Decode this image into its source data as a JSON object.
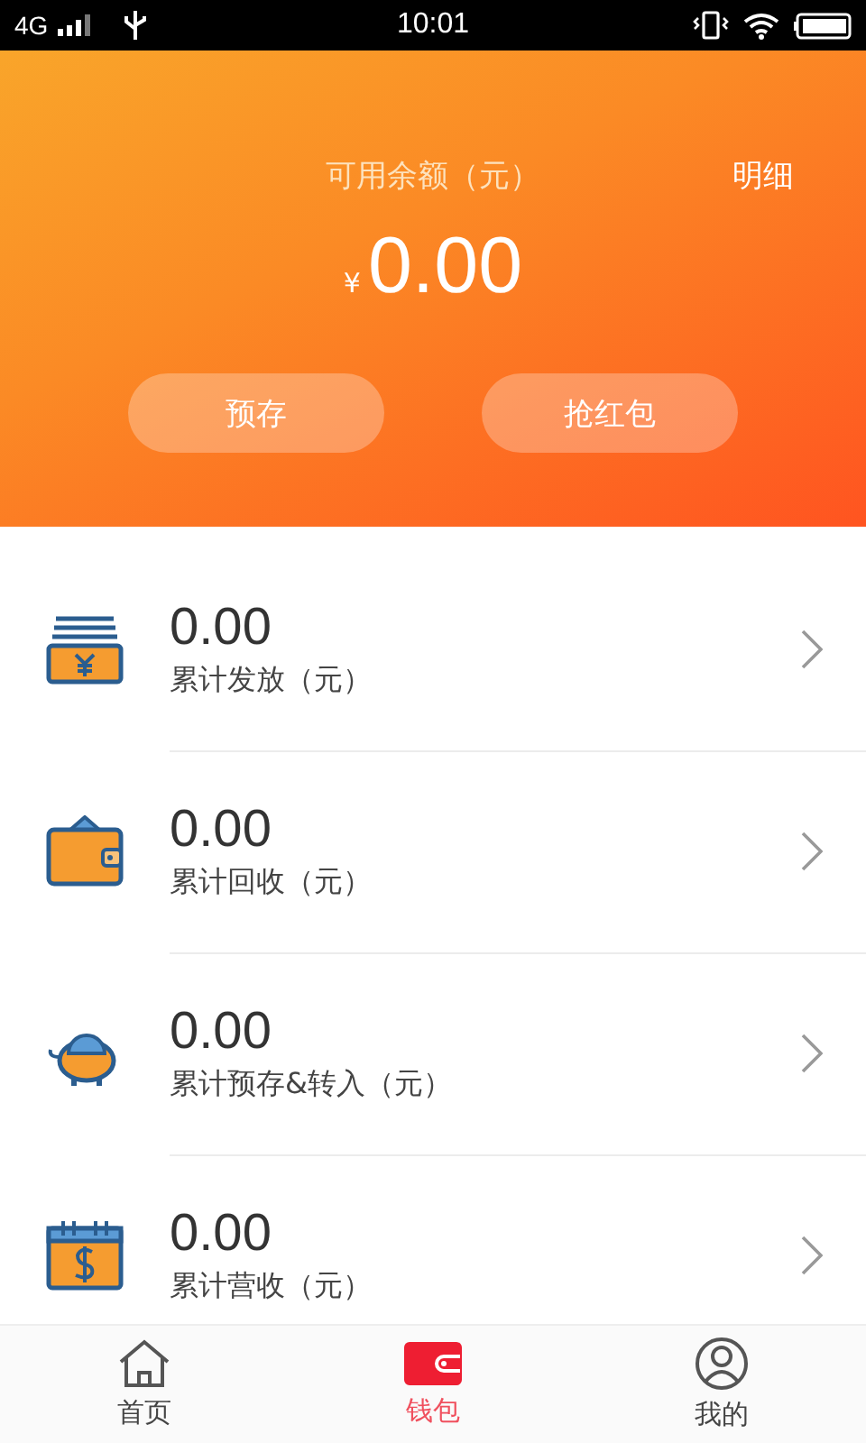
{
  "status_bar": {
    "network": "4G",
    "time": "10:01"
  },
  "header": {
    "balance_label": "可用余额（元）",
    "detail_link": "明细",
    "currency": "¥",
    "balance": "0.00",
    "buttons": [
      "预存",
      "抢红包"
    ]
  },
  "stats": [
    {
      "kind": "cash",
      "value": "0.00",
      "label": "累计发放（元）"
    },
    {
      "kind": "wallet",
      "value": "0.00",
      "label": "累计回收（元）"
    },
    {
      "kind": "piggy",
      "value": "0.00",
      "label": "累计预存&转入（元）"
    },
    {
      "kind": "calendar",
      "value": "0.00",
      "label": "累计营收（元）"
    }
  ],
  "tabs": [
    {
      "kind": "home",
      "label": "首页",
      "selected": false
    },
    {
      "kind": "wallet",
      "label": "钱包",
      "selected": true
    },
    {
      "kind": "user",
      "label": "我的",
      "selected": false
    }
  ]
}
